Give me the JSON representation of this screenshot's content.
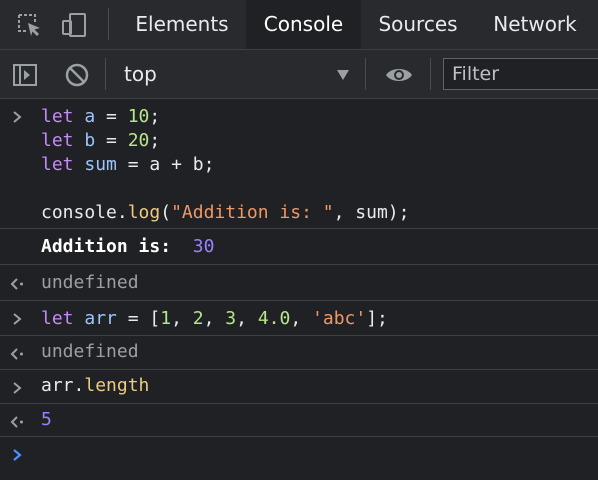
{
  "tabs": {
    "elements": "Elements",
    "console": "Console",
    "sources": "Sources",
    "network": "Network"
  },
  "toolbar": {
    "context": "top",
    "filter_placeholder": "Filter"
  },
  "entries": {
    "input1": {
      "line1": {
        "kw": "let",
        "var": "a",
        "op": " = ",
        "num": "10",
        "end": ";"
      },
      "line2": {
        "kw": "let",
        "var": "b",
        "op": " = ",
        "num": "20",
        "end": ";"
      },
      "line3": {
        "kw": "let",
        "var": "sum",
        "op1": " = ",
        "a": "a",
        "op2": " + ",
        "b": "b",
        "end": ";"
      },
      "line4": {
        "obj": "console.",
        "fn": "log",
        "open": "(",
        "str": "\"Addition is: \"",
        "rest": ", sum);"
      }
    },
    "log_output": {
      "text": "Addition is:",
      "value": "30"
    },
    "result1": "undefined",
    "input2": {
      "kw": "let",
      "var": "arr",
      "op": " = [",
      "n1": "1",
      "c1": ", ",
      "n2": "2",
      "c2": ", ",
      "n3": "3",
      "c3": ", ",
      "n4": "4.0",
      "c4": ", ",
      "str": "'abc'",
      "end": "];"
    },
    "result2": "undefined",
    "input3": {
      "obj": "arr.",
      "prop": "length"
    },
    "result3": "5"
  },
  "colors": {
    "background": "#202124",
    "keyword": "#c58af9",
    "variable": "#9cc4ff",
    "number": "#b6e58b",
    "string": "#f29766",
    "function": "#eccc80",
    "log_value": "#9980ff",
    "prompt": "#4d90fe"
  }
}
